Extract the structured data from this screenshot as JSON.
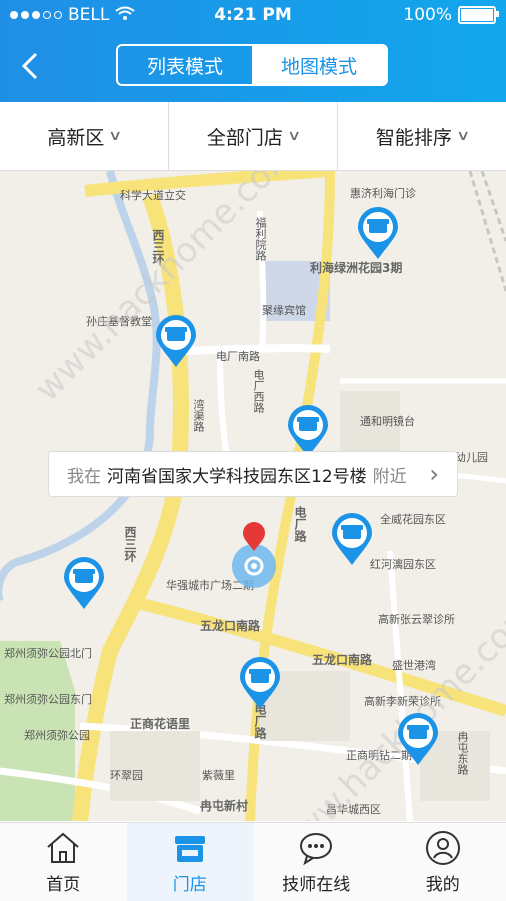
{
  "status": {
    "carrier": "BELL",
    "time": "4:21 PM",
    "battery": "100%"
  },
  "header": {
    "back_icon": "chevron-left-icon",
    "seg": {
      "list": "列表模式",
      "map": "地图模式"
    }
  },
  "filters": [
    {
      "label": "高新区"
    },
    {
      "label": "全部门店"
    },
    {
      "label": "智能排序"
    }
  ],
  "map": {
    "labels": {
      "l1": "科学大道立交",
      "l2": "惠济利海门诊",
      "l3": "福利院路",
      "l4": "西三环",
      "l5": "利海绿洲花园3期",
      "l6": "聚缘宾馆",
      "l7": "孙庄基督教堂",
      "l8": "电厂南路",
      "l9": "电厂西路",
      "l10": "湾渠路",
      "l11": "通和明镜台",
      "l12": "幼儿园",
      "l13": "全威花园东区",
      "l14": "红河漓园东区",
      "l15": "华强城市广场二期",
      "l16": "西三环",
      "l17": "电厂路",
      "l18": "五龙口南路",
      "l19": "五龙口南路",
      "l20": "高新张云翠诊所",
      "l21": "郑州须弥公园北门",
      "l22": "盛世港湾",
      "l23": "郑州须弥公园东门",
      "l24": "高新李新荣诊所",
      "l25": "郑州须弥公园",
      "l26": "正商花语里",
      "l27": "电厂路",
      "l28": "正商明钻二期",
      "l29": "冉屯东路",
      "l30": "环翠园",
      "l31": "紫薇里",
      "l32": "冉屯新村",
      "l33": "昌华城西区"
    },
    "callout": {
      "prefix": "我在",
      "address": "河南省国家大学科技园东区12号楼",
      "suffix": "附近"
    }
  },
  "watermark": "www.hackhome.com",
  "tabs": [
    {
      "label": "首页",
      "icon": "home-icon"
    },
    {
      "label": "门店",
      "icon": "store-icon"
    },
    {
      "label": "技师在线",
      "icon": "chat-icon"
    },
    {
      "label": "我的",
      "icon": "profile-icon"
    }
  ],
  "colors": {
    "accent": "#1b93e7",
    "road": "#f7e37a"
  }
}
